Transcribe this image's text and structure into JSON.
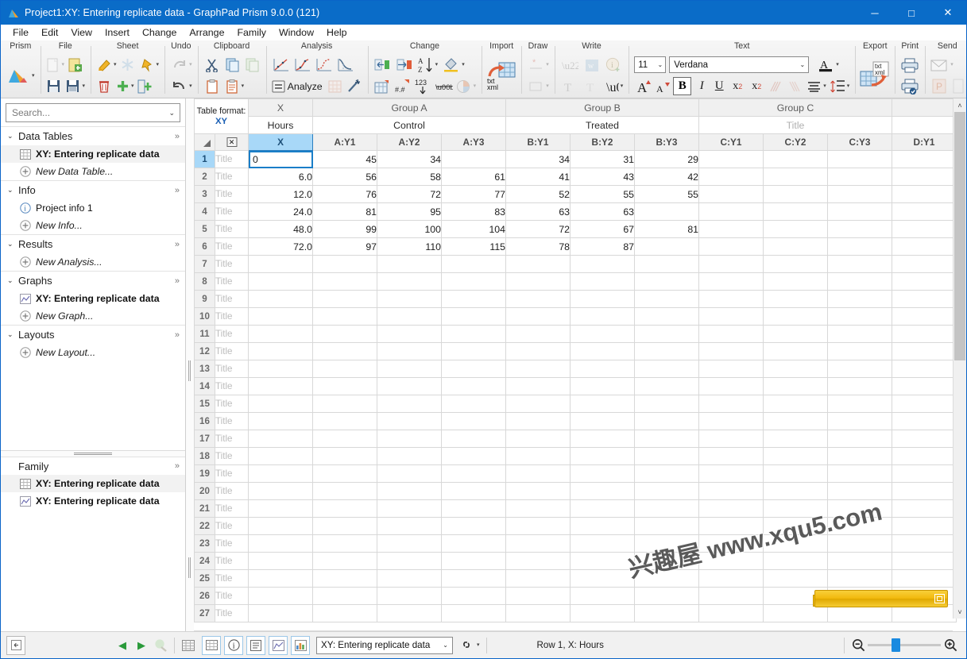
{
  "window": {
    "title": "Project1:XY: Entering replicate data - GraphPad Prism 9.0.0 (121)",
    "logo_icon": "prism-logo-icon",
    "minimize_label": "─",
    "maximize_label": "□",
    "close_label": "✕",
    "accent_color": "#0a6cc8"
  },
  "menubar": {
    "items": [
      {
        "label": "File"
      },
      {
        "label": "Edit"
      },
      {
        "label": "View"
      },
      {
        "label": "Insert"
      },
      {
        "label": "Change"
      },
      {
        "label": "Arrange"
      },
      {
        "label": "Family"
      },
      {
        "label": "Window"
      },
      {
        "label": "Help"
      }
    ]
  },
  "ribbon": {
    "groups": [
      {
        "name": "prism",
        "label": "Prism"
      },
      {
        "name": "file",
        "label": "File"
      },
      {
        "name": "sheet",
        "label": "Sheet"
      },
      {
        "name": "undo",
        "label": "Undo"
      },
      {
        "name": "clipboard",
        "label": "Clipboard"
      },
      {
        "name": "analysis",
        "label": "Analysis"
      },
      {
        "name": "change",
        "label": "Change"
      },
      {
        "name": "import",
        "label": "Import"
      },
      {
        "name": "draw",
        "label": "Draw"
      },
      {
        "name": "write",
        "label": "Write"
      },
      {
        "name": "text",
        "label": "Text"
      },
      {
        "name": "export",
        "label": "Export"
      },
      {
        "name": "print",
        "label": "Print"
      },
      {
        "name": "send",
        "label": "Send"
      }
    ],
    "analyze_label": "Analyze",
    "font_size": "11",
    "font_name": "Verdana",
    "bold_label": "B",
    "italic_label": "I",
    "underline_label": "U",
    "superscript_label": "x",
    "superscript_sup": "2",
    "subscript_label": "x",
    "subscript_sub": "2",
    "grow_font_label": "A",
    "shrink_font_label": "A",
    "greek_label": "α",
    "sqrt_label": "√a",
    "word_label": "w",
    "import_label_1": "txt",
    "import_label_2": "xml",
    "export_label_1": "txt",
    "export_label_2": "xml",
    "sort_az_a": "A",
    "sort_az_z": "Z",
    "num_123": "123",
    "num_dec": "#.#",
    "num_pm": "±.23",
    "text_color_label": "A"
  },
  "navigator": {
    "search": {
      "placeholder": "Search...",
      "value": ""
    },
    "sections": [
      {
        "label": "Data Tables",
        "expand_chevron": "⌄",
        "more": "»",
        "items": [
          {
            "label": "XY: Entering replicate data",
            "icon": "table-icon",
            "style": "bold",
            "selected": true
          },
          {
            "label": "New Data Table...",
            "icon": "plus-circle-icon",
            "style": "italic",
            "selected": false
          }
        ]
      },
      {
        "label": "Info",
        "expand_chevron": "⌄",
        "more": "»",
        "items": [
          {
            "label": "Project info 1",
            "icon": "info-circle-icon",
            "style": "normal",
            "selected": false
          },
          {
            "label": "New Info...",
            "icon": "plus-circle-icon",
            "style": "italic",
            "selected": false
          }
        ]
      },
      {
        "label": "Results",
        "expand_chevron": "⌄",
        "more": "»",
        "items": [
          {
            "label": "New Analysis...",
            "icon": "plus-circle-icon",
            "style": "italic",
            "selected": false
          }
        ]
      },
      {
        "label": "Graphs",
        "expand_chevron": "⌄",
        "more": "»",
        "items": [
          {
            "label": "XY: Entering replicate data",
            "icon": "graph-icon",
            "style": "bold",
            "selected": false
          },
          {
            "label": "New Graph...",
            "icon": "plus-circle-icon",
            "style": "italic",
            "selected": false
          }
        ]
      },
      {
        "label": "Layouts",
        "expand_chevron": "⌄",
        "more": "»",
        "items": [
          {
            "label": "New Layout...",
            "icon": "plus-circle-icon",
            "style": "italic",
            "selected": false
          }
        ]
      }
    ],
    "family": {
      "label": "Family",
      "more": "»",
      "items": [
        {
          "label": "XY: Entering replicate data",
          "icon": "table-icon",
          "selected": true
        },
        {
          "label": "XY: Entering replicate data",
          "icon": "graph-icon",
          "selected": false
        }
      ]
    }
  },
  "sheet": {
    "table_format": {
      "label": "Table format:",
      "value": "XY"
    },
    "close_col_label": "✕",
    "group_headers": [
      {
        "label": "X",
        "span": 1,
        "muted": true
      },
      {
        "label": "Group A",
        "span": 3,
        "muted": true
      },
      {
        "label": "Group B",
        "span": 3,
        "muted": true
      },
      {
        "label": "Group C",
        "span": 3,
        "muted": true
      },
      {
        "label": "",
        "span": 1,
        "muted": true
      }
    ],
    "title_row": [
      {
        "label": "Hours",
        "span": 1,
        "placeholder": false
      },
      {
        "label": "Control",
        "span": 3,
        "placeholder": false
      },
      {
        "label": "Treated",
        "span": 3,
        "placeholder": false
      },
      {
        "label": "Title",
        "span": 3,
        "placeholder": true
      },
      {
        "label": "",
        "span": 1,
        "placeholder": true
      }
    ],
    "columns": [
      {
        "label": "X",
        "selected": true
      },
      {
        "label": "A:Y1",
        "selected": false
      },
      {
        "label": "A:Y2",
        "selected": false
      },
      {
        "label": "A:Y3",
        "selected": false
      },
      {
        "label": "B:Y1",
        "selected": false
      },
      {
        "label": "B:Y2",
        "selected": false
      },
      {
        "label": "B:Y3",
        "selected": false
      },
      {
        "label": "C:Y1",
        "selected": false
      },
      {
        "label": "C:Y2",
        "selected": false
      },
      {
        "label": "C:Y3",
        "selected": false
      },
      {
        "label": "D:Y1",
        "selected": false
      }
    ],
    "row_title_placeholder": "Title",
    "active_cell": {
      "row": 1,
      "col": 0,
      "value": "0"
    },
    "rows": [
      {
        "n": "1",
        "cells": [
          "0",
          "45",
          "34",
          "",
          "34",
          "31",
          "29",
          "",
          "",
          "",
          ""
        ]
      },
      {
        "n": "2",
        "cells": [
          "6.0",
          "56",
          "58",
          "61",
          "41",
          "43",
          "42",
          "",
          "",
          "",
          ""
        ]
      },
      {
        "n": "3",
        "cells": [
          "12.0",
          "76",
          "72",
          "77",
          "52",
          "55",
          "55",
          "",
          "",
          "",
          ""
        ]
      },
      {
        "n": "4",
        "cells": [
          "24.0",
          "81",
          "95",
          "83",
          "63",
          "63",
          "",
          "",
          "",
          "",
          ""
        ]
      },
      {
        "n": "5",
        "cells": [
          "48.0",
          "99",
          "100",
          "104",
          "72",
          "67",
          "81",
          "",
          "",
          "",
          ""
        ]
      },
      {
        "n": "6",
        "cells": [
          "72.0",
          "97",
          "110",
          "115",
          "78",
          "87",
          "",
          "",
          "",
          "",
          ""
        ]
      },
      {
        "n": "7",
        "cells": [
          "",
          "",
          "",
          "",
          "",
          "",
          "",
          "",
          "",
          "",
          ""
        ]
      },
      {
        "n": "8",
        "cells": [
          "",
          "",
          "",
          "",
          "",
          "",
          "",
          "",
          "",
          "",
          ""
        ]
      },
      {
        "n": "9",
        "cells": [
          "",
          "",
          "",
          "",
          "",
          "",
          "",
          "",
          "",
          "",
          ""
        ]
      },
      {
        "n": "10",
        "cells": [
          "",
          "",
          "",
          "",
          "",
          "",
          "",
          "",
          "",
          "",
          ""
        ]
      },
      {
        "n": "11",
        "cells": [
          "",
          "",
          "",
          "",
          "",
          "",
          "",
          "",
          "",
          "",
          ""
        ]
      },
      {
        "n": "12",
        "cells": [
          "",
          "",
          "",
          "",
          "",
          "",
          "",
          "",
          "",
          "",
          ""
        ]
      },
      {
        "n": "13",
        "cells": [
          "",
          "",
          "",
          "",
          "",
          "",
          "",
          "",
          "",
          "",
          ""
        ]
      },
      {
        "n": "14",
        "cells": [
          "",
          "",
          "",
          "",
          "",
          "",
          "",
          "",
          "",
          "",
          ""
        ]
      },
      {
        "n": "15",
        "cells": [
          "",
          "",
          "",
          "",
          "",
          "",
          "",
          "",
          "",
          "",
          ""
        ]
      },
      {
        "n": "16",
        "cells": [
          "",
          "",
          "",
          "",
          "",
          "",
          "",
          "",
          "",
          "",
          ""
        ]
      },
      {
        "n": "17",
        "cells": [
          "",
          "",
          "",
          "",
          "",
          "",
          "",
          "",
          "",
          "",
          ""
        ]
      },
      {
        "n": "18",
        "cells": [
          "",
          "",
          "",
          "",
          "",
          "",
          "",
          "",
          "",
          "",
          ""
        ]
      },
      {
        "n": "19",
        "cells": [
          "",
          "",
          "",
          "",
          "",
          "",
          "",
          "",
          "",
          "",
          ""
        ]
      },
      {
        "n": "20",
        "cells": [
          "",
          "",
          "",
          "",
          "",
          "",
          "",
          "",
          "",
          "",
          ""
        ]
      },
      {
        "n": "21",
        "cells": [
          "",
          "",
          "",
          "",
          "",
          "",
          "",
          "",
          "",
          "",
          ""
        ]
      },
      {
        "n": "22",
        "cells": [
          "",
          "",
          "",
          "",
          "",
          "",
          "",
          "",
          "",
          "",
          ""
        ]
      },
      {
        "n": "23",
        "cells": [
          "",
          "",
          "",
          "",
          "",
          "",
          "",
          "",
          "",
          "",
          ""
        ]
      },
      {
        "n": "24",
        "cells": [
          "",
          "",
          "",
          "",
          "",
          "",
          "",
          "",
          "",
          "",
          ""
        ]
      },
      {
        "n": "25",
        "cells": [
          "",
          "",
          "",
          "",
          "",
          "",
          "",
          "",
          "",
          "",
          ""
        ]
      },
      {
        "n": "26",
        "cells": [
          "",
          "",
          "",
          "",
          "",
          "",
          "",
          "",
          "",
          "",
          ""
        ]
      },
      {
        "n": "27",
        "cells": [
          "",
          "",
          "",
          "",
          "",
          "",
          "",
          "",
          "",
          "",
          ""
        ]
      }
    ]
  },
  "scrollbars": {
    "v_up": "˄",
    "v_down": "˅",
    "h_left": "‹",
    "h_right": "›"
  },
  "statusbar": {
    "sheet_selector": {
      "value": "XY: Entering replicate data"
    },
    "status_text": "Row 1, X: Hours",
    "prev_label": "◀",
    "next_label": "▶",
    "zoom_out_label": "−",
    "zoom_in_label": "+",
    "zoom_value": 33
  },
  "watermark": {
    "text": "兴趣屋 www.xqu5.com"
  }
}
